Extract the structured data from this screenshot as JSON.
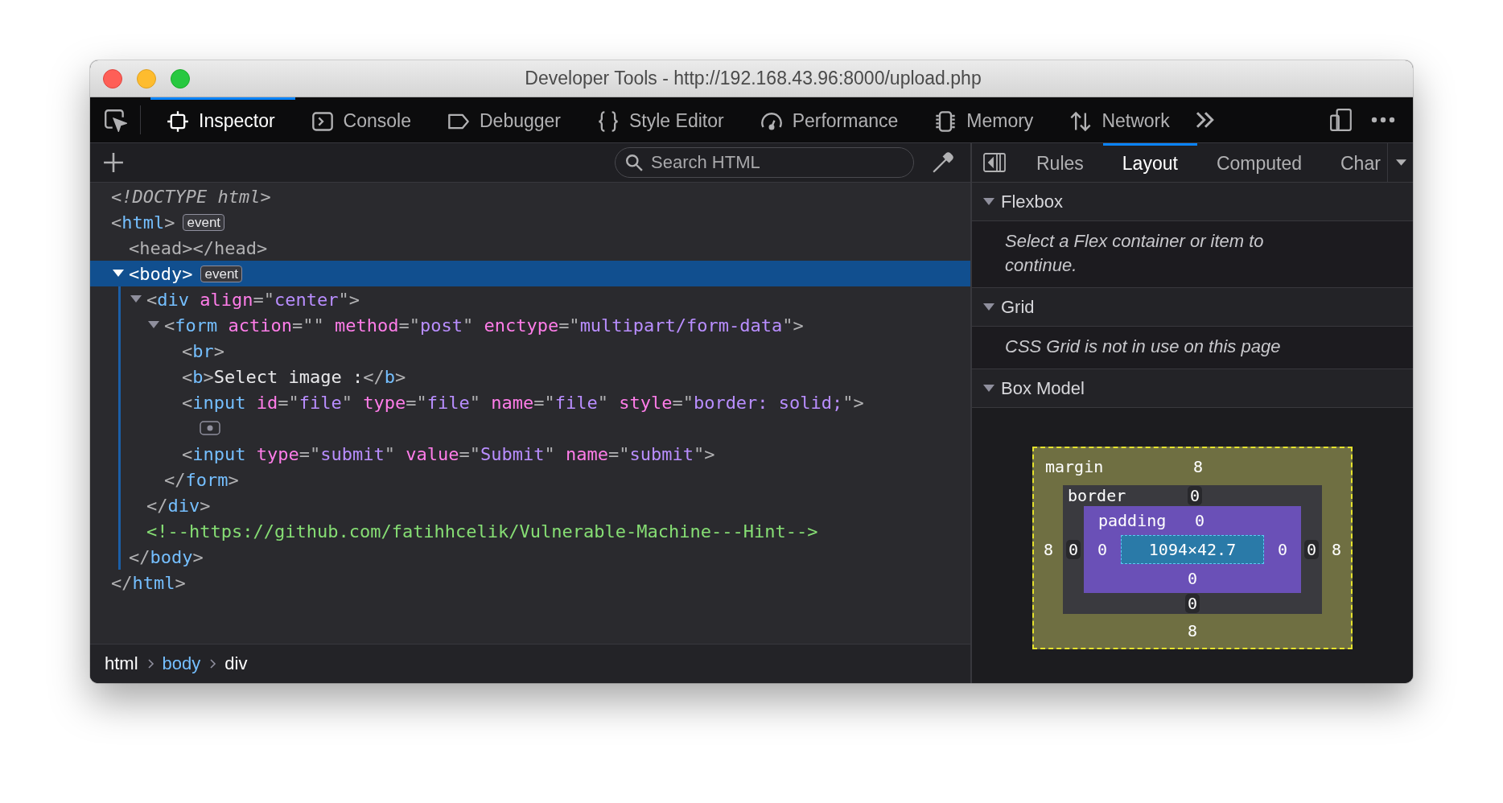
{
  "window": {
    "title": "Developer Tools - http://192.168.43.96:8000/upload.php"
  },
  "tools": [
    {
      "label": "Inspector",
      "selected": true
    },
    {
      "label": "Console",
      "selected": false
    },
    {
      "label": "Debugger",
      "selected": false
    },
    {
      "label": "Style Editor",
      "selected": false
    },
    {
      "label": "Performance",
      "selected": false
    },
    {
      "label": "Memory",
      "selected": false
    },
    {
      "label": "Network",
      "selected": false
    }
  ],
  "search": {
    "placeholder": "Search HTML"
  },
  "html_tree": [
    {
      "kind": "code",
      "selected": false,
      "tokens": [
        {
          "kind": "doctype",
          "text": "<!DOCTYPE html>"
        }
      ]
    },
    {
      "kind": "code",
      "selected": false,
      "badge": "event",
      "tokens": [
        {
          "kind": "punct",
          "text": "<"
        },
        {
          "kind": "tag",
          "text": "html"
        },
        {
          "kind": "punct",
          "text": ">"
        }
      ],
      "close": [
        {
          "kind": "punct",
          "text": "</"
        },
        {
          "kind": "tag",
          "text": "html"
        },
        {
          "kind": "punct",
          "text": ">"
        }
      ],
      "children": [
        {
          "kind": "code",
          "selected": false,
          "tokens": [
            {
              "kind": "punct",
              "text": "<head></head>"
            }
          ]
        },
        {
          "kind": "code",
          "selected": true,
          "expanded": true,
          "badge": "event",
          "tokens": [
            {
              "kind": "punct",
              "text": "<"
            },
            {
              "kind": "tag",
              "text": "body"
            },
            {
              "kind": "punct",
              "text": ">"
            }
          ],
          "close": [
            {
              "kind": "punct",
              "text": "</"
            },
            {
              "kind": "tag",
              "text": "body"
            },
            {
              "kind": "punct",
              "text": ">"
            }
          ],
          "children": [
            {
              "kind": "code",
              "selected": false,
              "expanded": true,
              "tokens": [
                {
                  "kind": "punct",
                  "text": "<"
                },
                {
                  "kind": "tag",
                  "text": "div"
                },
                {
                  "kind": "attr",
                  "text": " align"
                },
                {
                  "kind": "punct",
                  "text": "=\""
                },
                {
                  "kind": "value",
                  "text": "center"
                },
                {
                  "kind": "punct",
                  "text": "\">"
                }
              ],
              "close": [
                {
                  "kind": "punct",
                  "text": "</"
                },
                {
                  "kind": "tag",
                  "text": "div"
                },
                {
                  "kind": "punct",
                  "text": ">"
                }
              ],
              "children": [
                {
                  "kind": "code",
                  "selected": false,
                  "expanded": true,
                  "tokens": [
                    {
                      "kind": "punct",
                      "text": "<"
                    },
                    {
                      "kind": "tag",
                      "text": "form"
                    },
                    {
                      "kind": "attr",
                      "text": " action"
                    },
                    {
                      "kind": "punct",
                      "text": "=\"\" "
                    },
                    {
                      "kind": "attr",
                      "text": "method"
                    },
                    {
                      "kind": "punct",
                      "text": "=\""
                    },
                    {
                      "kind": "value",
                      "text": "post"
                    },
                    {
                      "kind": "punct",
                      "text": "\" "
                    },
                    {
                      "kind": "attr",
                      "text": "enctype"
                    },
                    {
                      "kind": "punct",
                      "text": "=\""
                    },
                    {
                      "kind": "value",
                      "text": "multipart/form-data"
                    },
                    {
                      "kind": "punct",
                      "text": "\">"
                    }
                  ],
                  "close": [
                    {
                      "kind": "punct",
                      "text": "</"
                    },
                    {
                      "kind": "tag",
                      "text": "form"
                    },
                    {
                      "kind": "punct",
                      "text": ">"
                    }
                  ],
                  "children": [
                    {
                      "kind": "code",
                      "selected": false,
                      "tokens": [
                        {
                          "kind": "punct",
                          "text": "<"
                        },
                        {
                          "kind": "tag",
                          "text": "br"
                        },
                        {
                          "kind": "punct",
                          "text": ">"
                        }
                      ]
                    },
                    {
                      "kind": "code",
                      "selected": false,
                      "tokens": [
                        {
                          "kind": "punct",
                          "text": "<"
                        },
                        {
                          "kind": "tag",
                          "text": "b"
                        },
                        {
                          "kind": "punct",
                          "text": ">"
                        },
                        {
                          "kind": "text",
                          "text": "Select image :"
                        },
                        {
                          "kind": "punct",
                          "text": "</"
                        },
                        {
                          "kind": "tag",
                          "text": "b"
                        },
                        {
                          "kind": "punct",
                          "text": ">"
                        }
                      ]
                    },
                    {
                      "kind": "code",
                      "selected": false,
                      "tokens": [
                        {
                          "kind": "punct",
                          "text": "<"
                        },
                        {
                          "kind": "tag",
                          "text": "input"
                        },
                        {
                          "kind": "attr",
                          "text": " id"
                        },
                        {
                          "kind": "punct",
                          "text": "=\""
                        },
                        {
                          "kind": "value",
                          "text": "file"
                        },
                        {
                          "kind": "punct",
                          "text": "\" "
                        },
                        {
                          "kind": "attr",
                          "text": "type"
                        },
                        {
                          "kind": "punct",
                          "text": "=\""
                        },
                        {
                          "kind": "value",
                          "text": "file"
                        },
                        {
                          "kind": "punct",
                          "text": "\" "
                        },
                        {
                          "kind": "attr",
                          "text": "name"
                        },
                        {
                          "kind": "punct",
                          "text": "=\""
                        },
                        {
                          "kind": "value",
                          "text": "file"
                        },
                        {
                          "kind": "punct",
                          "text": "\" "
                        },
                        {
                          "kind": "attr",
                          "text": "style"
                        },
                        {
                          "kind": "punct",
                          "text": "=\""
                        },
                        {
                          "kind": "value",
                          "text": "border: solid;"
                        },
                        {
                          "kind": "punct",
                          "text": "\">"
                        }
                      ],
                      "children": [
                        {
                          "kind": "icon",
                          "selected": false
                        }
                      ]
                    },
                    {
                      "kind": "code",
                      "selected": false,
                      "tokens": [
                        {
                          "kind": "punct",
                          "text": "<"
                        },
                        {
                          "kind": "tag",
                          "text": "input"
                        },
                        {
                          "kind": "attr",
                          "text": " type"
                        },
                        {
                          "kind": "punct",
                          "text": "=\""
                        },
                        {
                          "kind": "value",
                          "text": "submit"
                        },
                        {
                          "kind": "punct",
                          "text": "\" "
                        },
                        {
                          "kind": "attr",
                          "text": "value"
                        },
                        {
                          "kind": "punct",
                          "text": "=\""
                        },
                        {
                          "kind": "value",
                          "text": "Submit"
                        },
                        {
                          "kind": "punct",
                          "text": "\" "
                        },
                        {
                          "kind": "attr",
                          "text": "name"
                        },
                        {
                          "kind": "punct",
                          "text": "=\""
                        },
                        {
                          "kind": "value",
                          "text": "submit"
                        },
                        {
                          "kind": "punct",
                          "text": "\">"
                        }
                      ]
                    }
                  ]
                }
              ]
            },
            {
              "kind": "code",
              "selected": false,
              "tokens": [
                {
                  "kind": "comment",
                  "text": "<!--https://github.com/fatihhcelik/Vulnerable-Machine---Hint-->"
                }
              ]
            }
          ]
        }
      ]
    }
  ],
  "breadcrumbs": [
    {
      "label": "html",
      "selected": false
    },
    {
      "label": "body",
      "selected": true
    },
    {
      "label": "div",
      "selected": false
    }
  ],
  "sidebar": {
    "tabs": [
      {
        "label": "Rules",
        "selected": false
      },
      {
        "label": "Layout",
        "selected": true
      },
      {
        "label": "Computed",
        "selected": false
      },
      {
        "label": "Char",
        "selected": false
      }
    ],
    "sections": [
      {
        "title": "Flexbox",
        "expanded": true,
        "kind": "note",
        "text": "Select a Flex container or item to continue."
      },
      {
        "title": "Grid",
        "expanded": true,
        "kind": "note",
        "text": "CSS Grid is not in use on this page"
      },
      {
        "title": "Box Model",
        "expanded": true,
        "kind": "box_model",
        "box_model": {
          "layers": [
            {
              "kind": "margin",
              "label": "margin"
            },
            {
              "kind": "border",
              "label": "border"
            },
            {
              "kind": "padding",
              "label": "padding"
            }
          ],
          "top_outer_to_inner": [
            "8",
            "0",
            "0"
          ],
          "left_outer_to_inner": [
            "8",
            "0",
            "0"
          ],
          "content": "1094×42.7",
          "right_inner_to_outer": [
            "0",
            "0",
            "8"
          ],
          "bottom_inner_to_outer": [
            "0",
            "0",
            "8"
          ]
        }
      }
    ]
  }
}
